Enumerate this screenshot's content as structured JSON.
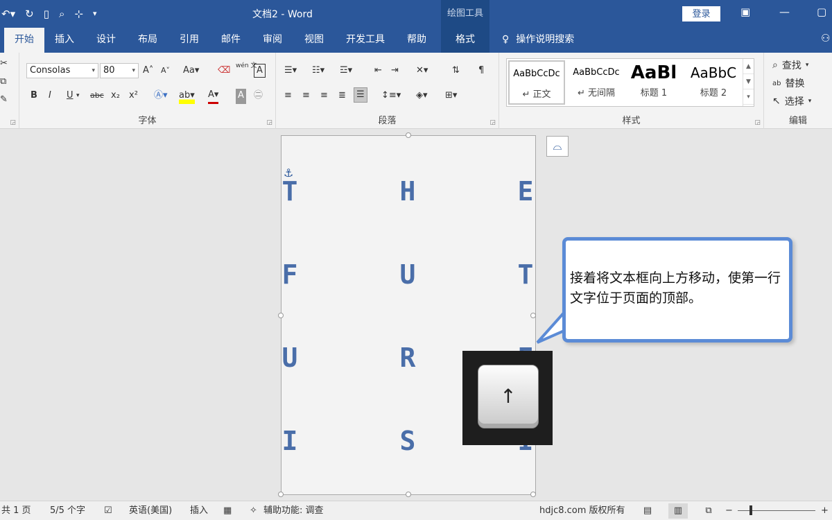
{
  "app": {
    "doc_title": "文档2 - Word",
    "context_tab_group": "绘图工具",
    "login_label": "登录"
  },
  "tabs": [
    {
      "label": "开始",
      "active": true
    },
    {
      "label": "插入"
    },
    {
      "label": "设计"
    },
    {
      "label": "布局"
    },
    {
      "label": "引用"
    },
    {
      "label": "邮件"
    },
    {
      "label": "审阅"
    },
    {
      "label": "视图"
    },
    {
      "label": "开发工具"
    },
    {
      "label": "帮助"
    },
    {
      "label": "格式",
      "contextual": true
    }
  ],
  "tell_me": "操作说明搜索",
  "ribbon": {
    "font": {
      "label": "字体",
      "name": "Consolas",
      "size": "80",
      "aa_label": "Aa",
      "bold": "B",
      "italic": "I",
      "underline": "U",
      "strike": "abc",
      "sub": "x₂",
      "sup": "x²",
      "grow": "A",
      "shrink": "A",
      "phonetic": "wén 文"
    },
    "paragraph": {
      "label": "段落"
    },
    "styles": {
      "label": "样式",
      "items": [
        {
          "preview": "AaBbCcDc",
          "name": "↵ 正文"
        },
        {
          "preview": "AaBbCcDc",
          "name": "↵ 无间隔"
        },
        {
          "preview": "AaBl",
          "name": "标题 1"
        },
        {
          "preview": "AaBbC",
          "name": "标题 2"
        }
      ]
    },
    "editing": {
      "label": "编辑",
      "find": "查找",
      "replace": "替换",
      "select": "选择"
    }
  },
  "document": {
    "letters": [
      "T",
      "H",
      "E",
      "F",
      "U",
      "T",
      "U",
      "R",
      "E",
      "I",
      "S",
      "I"
    ]
  },
  "callout": {
    "text": "接着将文本框向上方移动，使第一行文字位于页面的顶部。"
  },
  "key_overlay": {
    "glyph": "↑"
  },
  "statusbar": {
    "page": "共 1 页",
    "words": "5/5 个字",
    "language": "英语(美国)",
    "mode": "插入",
    "accessibility": "辅助功能: 调查",
    "watermark": "hdjc8.com 版权所有",
    "zoom_minus": "−",
    "zoom_plus": "+"
  },
  "colors": {
    "brand": "#2b579a",
    "letter": "#4a6ea9",
    "callout_border": "#5b8bd6"
  }
}
